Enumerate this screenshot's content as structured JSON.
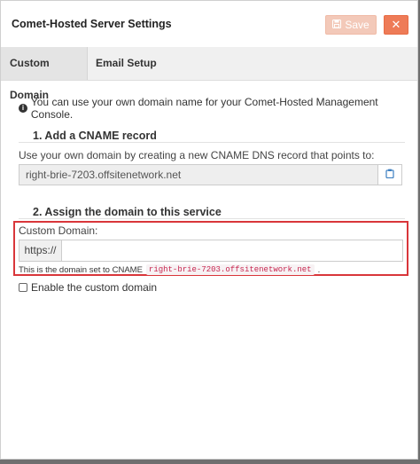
{
  "dialog": {
    "title": "Comet-Hosted Server Settings",
    "save_label": "Save",
    "close_label": "✕"
  },
  "tabs": [
    {
      "label": "Custom Domain",
      "active": true
    },
    {
      "label": "Email Setup",
      "active": false
    }
  ],
  "info_text": "You can use your own domain name for your Comet-Hosted Management Console.",
  "step1": {
    "heading": "1. Add a CNAME record",
    "description": "Use your own domain by creating a new CNAME DNS record that points to:",
    "cname_value": "right-brie-7203.offsitenetwork.net"
  },
  "step2": {
    "heading": "2. Assign the domain to this service",
    "field_label": "Custom Domain:",
    "prefix": "https://",
    "value": "",
    "help_prefix": "This is the domain set to CNAME",
    "help_code": "right-brie-7203.offsitenetwork.net",
    "help_suffix": "."
  },
  "enable_label": "Enable the custom domain",
  "colors": {
    "accent": "#ee7b57",
    "highlight_border": "#d9363a",
    "code_text": "#c7254e"
  },
  "icons": {
    "save": "floppy-disk-icon",
    "close": "close-icon",
    "info": "info-circle-icon",
    "copy": "clipboard-icon"
  }
}
